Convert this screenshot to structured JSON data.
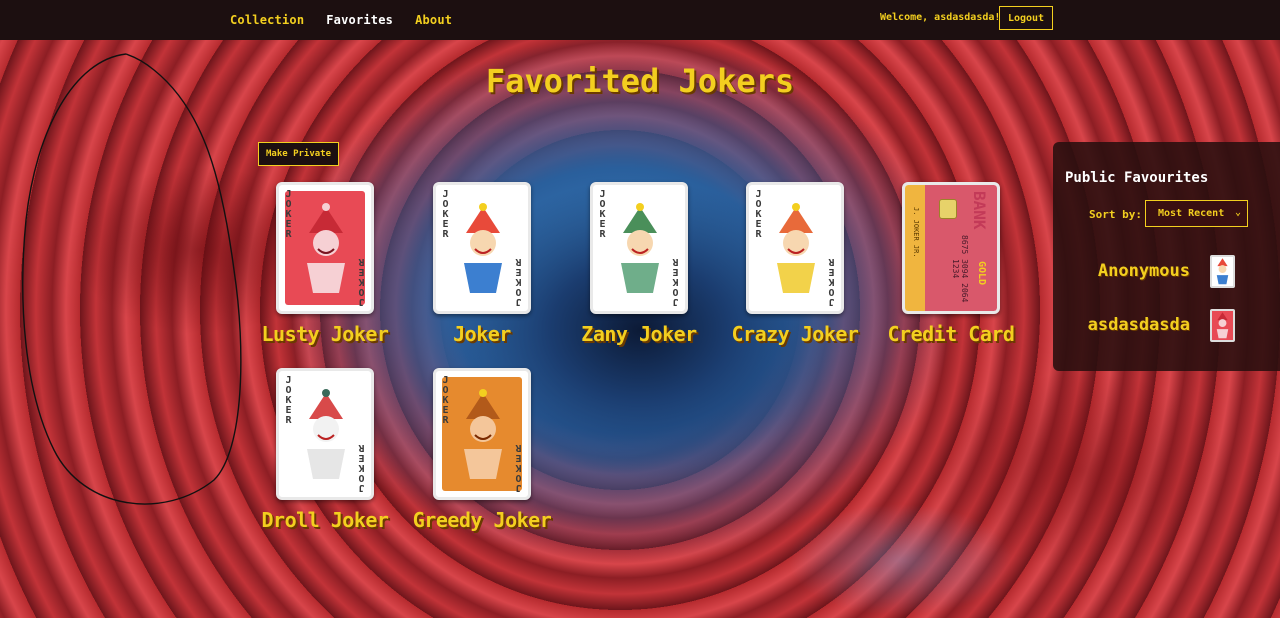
{
  "nav": {
    "links": [
      "Collection",
      "Favorites",
      "About"
    ],
    "active": "Favorites",
    "welcome": "Welcome, asdasdasda!",
    "logout": "Logout"
  },
  "page": {
    "title": "Favorited Jokers",
    "privacy_button": "Make Private"
  },
  "cards": [
    {
      "name": "Lusty Joker",
      "style": "red",
      "bg": "#e84a55",
      "hat": "#c72a36"
    },
    {
      "name": "Joker",
      "style": "white",
      "bg": "#ffffff",
      "hat": "#e84a3a"
    },
    {
      "name": "Zany Joker",
      "style": "white",
      "bg": "#ffffff",
      "hat": "#4a8f5a"
    },
    {
      "name": "Crazy Joker",
      "style": "white",
      "bg": "#ffffff",
      "hat": "#e86a3a"
    },
    {
      "name": "Credit Card",
      "style": "credit",
      "bg": "#d9586b",
      "hat": ""
    },
    {
      "name": "Droll Joker",
      "style": "white",
      "bg": "#ffffff",
      "hat": "#d84a4a"
    },
    {
      "name": "Greedy Joker",
      "style": "orange",
      "bg": "#e68a2e",
      "hat": "#b25a1a"
    }
  ],
  "card_tag": "JOKER",
  "credit_card": {
    "bank": "BANK",
    "gold": "GOLD",
    "number": "8675 3094 2064 1234",
    "holder": "J. JOKER JR."
  },
  "side_panel": {
    "title": "Public Favourites",
    "sort_label": "Sort by:",
    "sort_value": "Most Recent",
    "users": [
      {
        "name": "Anonymous",
        "card": "Joker"
      },
      {
        "name": "asdasdasda",
        "card": "Lusty Joker"
      }
    ]
  }
}
